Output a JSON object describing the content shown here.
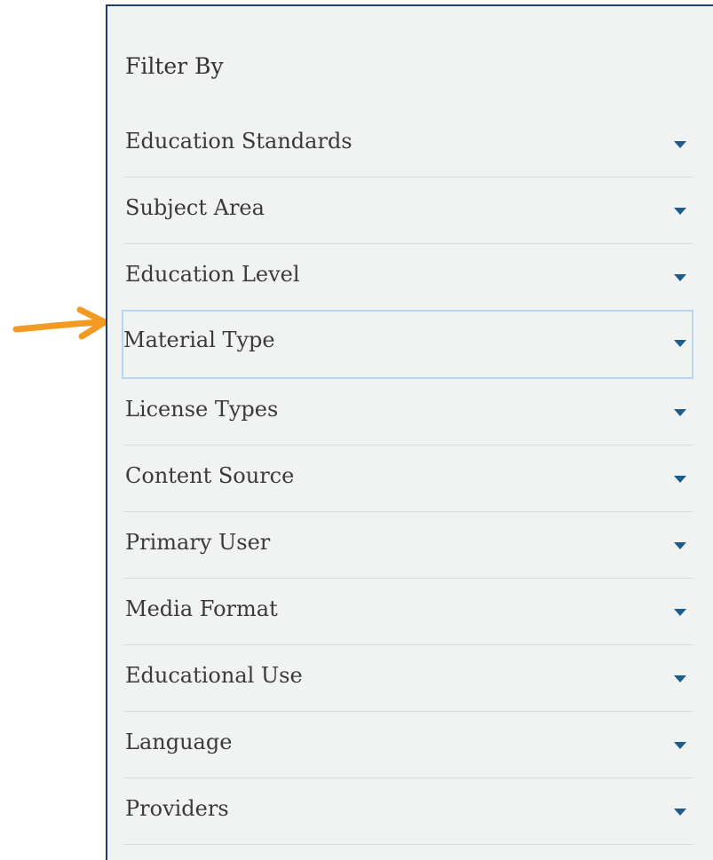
{
  "panel": {
    "title": "Filter By"
  },
  "filters": [
    {
      "label": "Education Standards",
      "focused": false
    },
    {
      "label": "Subject Area",
      "focused": false
    },
    {
      "label": "Education Level",
      "focused": false
    },
    {
      "label": "Material Type",
      "focused": true
    },
    {
      "label": "License Types",
      "focused": false
    },
    {
      "label": "Content Source",
      "focused": false
    },
    {
      "label": "Primary User",
      "focused": false
    },
    {
      "label": "Media Format",
      "focused": false
    },
    {
      "label": "Educational Use",
      "focused": false
    },
    {
      "label": "Language",
      "focused": false
    },
    {
      "label": "Providers",
      "focused": false
    }
  ],
  "icons": {
    "caret": "caret-down-icon",
    "pointer": "orange-arrow-icon"
  },
  "colors": {
    "panel_background": "#f1f2f2",
    "panel_border": "#1f3d6e",
    "caret": "#1b5c8c",
    "focus_outline": "#b9d3f3",
    "annotation_arrow": "#f29a22"
  }
}
